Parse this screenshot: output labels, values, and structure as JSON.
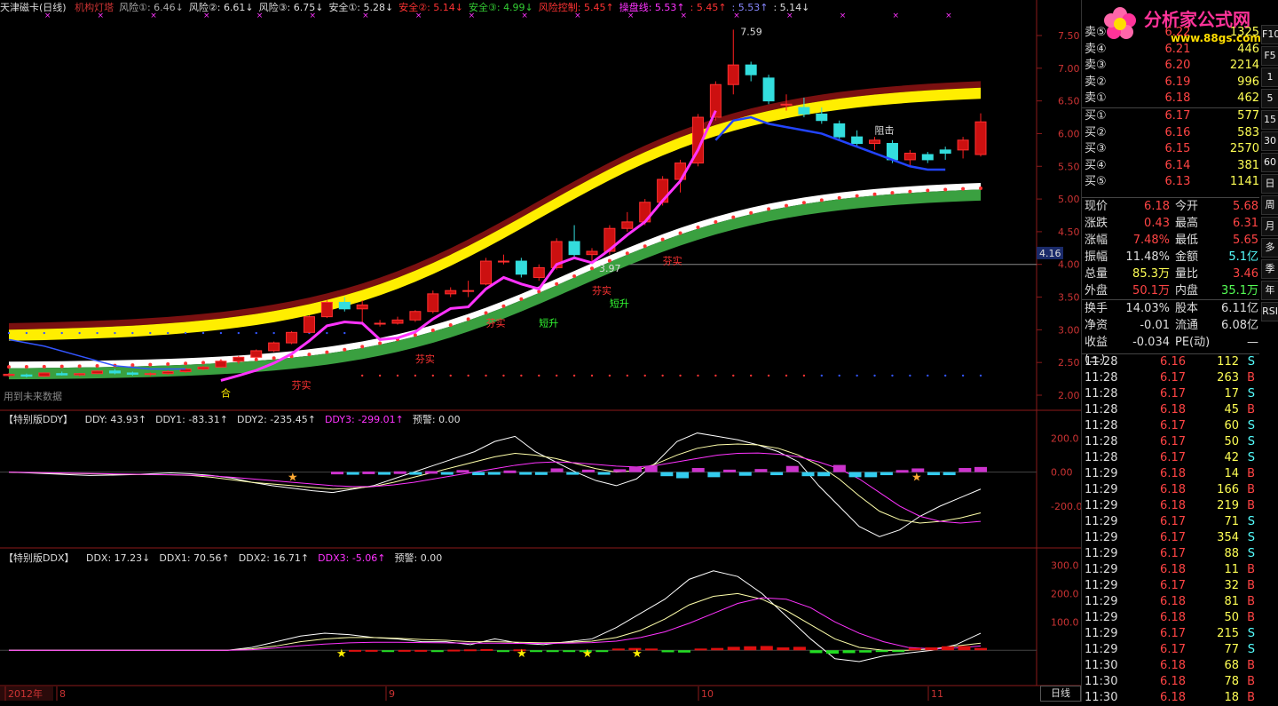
{
  "header": {
    "title": "天津磁卡(日线)",
    "items": [
      {
        "label": "机构灯塔",
        "color": "#cc3333"
      },
      {
        "label": "风险①: 6.46↓",
        "color": "#aaaaaa"
      },
      {
        "label": "风险②: 6.61↓",
        "color": "#dddddd"
      },
      {
        "label": "风险③: 6.75↓",
        "color": "#dddddd"
      },
      {
        "label": "安全①: 5.28↓",
        "color": "#dddddd"
      },
      {
        "label": "安全②: 5.14↓",
        "color": "#ff3333"
      },
      {
        "label": "安全③: 4.99↓",
        "color": "#33cc33"
      },
      {
        "label": "风险控制: 5.45↑",
        "color": "#ff3333"
      },
      {
        "label": "操盘线: 5.53↑",
        "color": "#ff33ff"
      },
      {
        "label": ": 5.45↑",
        "color": "#ff3333"
      },
      {
        "label": ": 5.53↑",
        "color": "#8888ff"
      },
      {
        "label": ": 5.14↓",
        "color": "#dddddd"
      }
    ]
  },
  "main_panel": {
    "future_note": "用到未来数据",
    "annotations": [
      "芬实",
      "芬实",
      "芬实",
      "芬实",
      "芬实",
      "短升",
      "短升",
      "阻击",
      "合"
    ],
    "high_label": "7.59",
    "low_label": "3.97",
    "current_price_box": "4.16",
    "y_ticks": [
      "7.50",
      "7.00",
      "6.50",
      "6.00",
      "5.50",
      "5.00",
      "4.50",
      "4.00",
      "3.50",
      "3.00",
      "2.50",
      "2.00"
    ]
  },
  "ddy_panel": {
    "title": "【特别版DDY】",
    "items": [
      {
        "label": "DDY: 43.93↑",
        "color": "#dddddd"
      },
      {
        "label": "DDY1: -83.31↑",
        "color": "#dddddd"
      },
      {
        "label": "DDY2: -235.45↑",
        "color": "#dddddd"
      },
      {
        "label": "DDY3: -299.01↑",
        "color": "#ff33ff"
      },
      {
        "label": "预警: 0.00",
        "color": "#dddddd"
      }
    ],
    "y_ticks": [
      "200.0",
      "0.00",
      "-200.0"
    ]
  },
  "ddx_panel": {
    "title": "【特别版DDX】",
    "items": [
      {
        "label": "DDX: 17.23↓",
        "color": "#dddddd"
      },
      {
        "label": "DDX1: 70.56↑",
        "color": "#dddddd"
      },
      {
        "label": "DDX2: 16.71↑",
        "color": "#dddddd"
      },
      {
        "label": "DDX3: -5.06↑",
        "color": "#ff33ff"
      },
      {
        "label": "预警: 0.00",
        "color": "#dddddd"
      }
    ],
    "y_ticks": [
      "300.0",
      "200.0",
      "100.0"
    ]
  },
  "time_axis": {
    "labels": [
      "2012年",
      "8",
      "9",
      "10",
      "11"
    ],
    "period": "日线"
  },
  "logo": {
    "title": "分析家公式网",
    "url_text": "www.88gs.com"
  },
  "order_book": {
    "asks": [
      {
        "label": "卖⑤",
        "price": "6.22",
        "vol": "1325"
      },
      {
        "label": "卖④",
        "price": "6.21",
        "vol": "446"
      },
      {
        "label": "卖③",
        "price": "6.20",
        "vol": "2214"
      },
      {
        "label": "卖②",
        "price": "6.19",
        "vol": "996"
      },
      {
        "label": "卖①",
        "price": "6.18",
        "vol": "462"
      }
    ],
    "bids": [
      {
        "label": "买①",
        "price": "6.17",
        "vol": "577"
      },
      {
        "label": "买②",
        "price": "6.16",
        "vol": "583"
      },
      {
        "label": "买③",
        "price": "6.15",
        "vol": "2570"
      },
      {
        "label": "买④",
        "price": "6.14",
        "vol": "381"
      },
      {
        "label": "买⑤",
        "price": "6.13",
        "vol": "1141"
      }
    ]
  },
  "stats": [
    {
      "k1": "现价",
      "v1": "6.18",
      "c1": "#ff4444",
      "k2": "今开",
      "v2": "5.68",
      "c2": "#ff4444"
    },
    {
      "k1": "涨跌",
      "v1": "0.43",
      "c1": "#ff4444",
      "k2": "最高",
      "v2": "6.31",
      "c2": "#ff4444"
    },
    {
      "k1": "涨幅",
      "v1": "7.48%",
      "c1": "#ff4444",
      "k2": "最低",
      "v2": "5.65",
      "c2": "#ff4444"
    },
    {
      "k1": "振幅",
      "v1": "11.48%",
      "c1": "#dddddd",
      "k2": "金额",
      "v2": "5.1亿",
      "c2": "#55ffff"
    },
    {
      "k1": "总量",
      "v1": "85.3万",
      "c1": "#ffff55",
      "k2": "量比",
      "v2": "3.46",
      "c2": "#ff4444"
    },
    {
      "k1": "外盘",
      "v1": "50.1万",
      "c1": "#ff4444",
      "k2": "内盘",
      "v2": "35.1万",
      "c2": "#55ff55"
    },
    {
      "k1": "换手",
      "v1": "14.03%",
      "c1": "#dddddd",
      "k2": "股本",
      "v2": "6.11亿",
      "c2": "#dddddd"
    },
    {
      "k1": "净资",
      "v1": "-0.01",
      "c1": "#dddddd",
      "k2": "流通",
      "v2": "6.08亿",
      "c2": "#dddddd"
    },
    {
      "k1": "收益(三)",
      "v1": "-0.034",
      "c1": "#dddddd",
      "k2": "PE(动)",
      "v2": "—",
      "c2": "#dddddd"
    }
  ],
  "ticks": [
    {
      "t": "11:28",
      "p": "6.16",
      "q": "112",
      "s": "S"
    },
    {
      "t": "11:28",
      "p": "6.17",
      "q": "263",
      "s": "B"
    },
    {
      "t": "11:28",
      "p": "6.17",
      "q": "17",
      "s": "S"
    },
    {
      "t": "11:28",
      "p": "6.18",
      "q": "45",
      "s": "B"
    },
    {
      "t": "11:28",
      "p": "6.17",
      "q": "60",
      "s": "S"
    },
    {
      "t": "11:28",
      "p": "6.17",
      "q": "50",
      "s": "S"
    },
    {
      "t": "11:28",
      "p": "6.17",
      "q": "42",
      "s": "S"
    },
    {
      "t": "11:29",
      "p": "6.18",
      "q": "14",
      "s": "B"
    },
    {
      "t": "11:29",
      "p": "6.18",
      "q": "166",
      "s": "B"
    },
    {
      "t": "11:29",
      "p": "6.18",
      "q": "219",
      "s": "B"
    },
    {
      "t": "11:29",
      "p": "6.17",
      "q": "71",
      "s": "S"
    },
    {
      "t": "11:29",
      "p": "6.17",
      "q": "354",
      "s": "S"
    },
    {
      "t": "11:29",
      "p": "6.17",
      "q": "88",
      "s": "S"
    },
    {
      "t": "11:29",
      "p": "6.18",
      "q": "11",
      "s": "B"
    },
    {
      "t": "11:29",
      "p": "6.17",
      "q": "32",
      "s": "B"
    },
    {
      "t": "11:29",
      "p": "6.18",
      "q": "81",
      "s": "B"
    },
    {
      "t": "11:29",
      "p": "6.18",
      "q": "50",
      "s": "B"
    },
    {
      "t": "11:29",
      "p": "6.17",
      "q": "215",
      "s": "S"
    },
    {
      "t": "11:29",
      "p": "6.17",
      "q": "77",
      "s": "S"
    },
    {
      "t": "11:30",
      "p": "6.18",
      "q": "68",
      "s": "B"
    },
    {
      "t": "11:30",
      "p": "6.18",
      "q": "78",
      "s": "B"
    },
    {
      "t": "11:30",
      "p": "6.18",
      "q": "18",
      "s": "B"
    }
  ],
  "toolbar": [
    "F10",
    "F5",
    "1",
    "5",
    "15",
    "30",
    "60",
    "日",
    "周",
    "月",
    "多",
    "季",
    "年",
    "RSI"
  ],
  "chart_data": {
    "type": "candlestick",
    "title": "天津磁卡(日线)",
    "ylim": [
      1.8,
      7.8
    ],
    "x_months": [
      "8",
      "9",
      "10",
      "11"
    ],
    "candles": [
      [
        2.3,
        2.34,
        2.28,
        2.32
      ],
      [
        2.31,
        2.33,
        2.27,
        2.29
      ],
      [
        2.29,
        2.35,
        2.28,
        2.34
      ],
      [
        2.33,
        2.36,
        2.3,
        2.31
      ],
      [
        2.31,
        2.34,
        2.29,
        2.33
      ],
      [
        2.33,
        2.38,
        2.32,
        2.37
      ],
      [
        2.37,
        2.4,
        2.32,
        2.34
      ],
      [
        2.34,
        2.36,
        2.3,
        2.32
      ],
      [
        2.32,
        2.35,
        2.29,
        2.33
      ],
      [
        2.33,
        2.38,
        2.31,
        2.36
      ],
      [
        2.36,
        2.42,
        2.34,
        2.4
      ],
      [
        2.4,
        2.45,
        2.38,
        2.43
      ],
      [
        2.43,
        2.55,
        2.42,
        2.52
      ],
      [
        2.52,
        2.6,
        2.48,
        2.58
      ],
      [
        2.58,
        2.7,
        2.56,
        2.68
      ],
      [
        2.68,
        2.82,
        2.66,
        2.8
      ],
      [
        2.8,
        2.98,
        2.78,
        2.96
      ],
      [
        2.96,
        3.22,
        2.95,
        3.2
      ],
      [
        3.2,
        3.45,
        3.18,
        3.42
      ],
      [
        3.42,
        3.5,
        3.28,
        3.32
      ],
      [
        3.32,
        3.45,
        3.1,
        3.38
      ],
      [
        3.1,
        3.15,
        3.05,
        3.1
      ],
      [
        3.1,
        3.2,
        3.08,
        3.15
      ],
      [
        3.15,
        3.3,
        3.12,
        3.28
      ],
      [
        3.28,
        3.6,
        3.25,
        3.55
      ],
      [
        3.55,
        3.65,
        3.5,
        3.6
      ],
      [
        3.6,
        3.75,
        3.5,
        3.6
      ],
      [
        3.7,
        4.1,
        3.68,
        4.05
      ],
      [
        4.05,
        4.15,
        4.0,
        4.05
      ],
      [
        4.05,
        4.1,
        3.8,
        3.85
      ],
      [
        3.8,
        4.0,
        3.75,
        3.95
      ],
      [
        3.95,
        4.4,
        3.92,
        4.35
      ],
      [
        4.35,
        4.6,
        4.1,
        4.15
      ],
      [
        4.15,
        4.25,
        4.05,
        4.2
      ],
      [
        4.2,
        4.6,
        4.15,
        4.55
      ],
      [
        4.55,
        4.8,
        4.5,
        4.65
      ],
      [
        4.65,
        5.0,
        4.6,
        4.95
      ],
      [
        4.95,
        5.35,
        4.9,
        5.3
      ],
      [
        5.3,
        5.6,
        5.1,
        5.55
      ],
      [
        5.55,
        6.3,
        5.5,
        6.25
      ],
      [
        6.25,
        6.8,
        6.2,
        6.75
      ],
      [
        6.75,
        7.59,
        6.6,
        7.05
      ],
      [
        7.05,
        7.1,
        6.8,
        6.9
      ],
      [
        6.85,
        6.9,
        6.45,
        6.5
      ],
      [
        6.45,
        6.6,
        6.35,
        6.45
      ],
      [
        6.4,
        6.55,
        6.25,
        6.3
      ],
      [
        6.3,
        6.4,
        6.15,
        6.2
      ],
      [
        6.15,
        6.2,
        5.9,
        5.95
      ],
      [
        5.95,
        6.05,
        5.8,
        5.85
      ],
      [
        5.85,
        5.95,
        5.75,
        5.9
      ],
      [
        5.85,
        5.9,
        5.55,
        5.6
      ],
      [
        5.6,
        5.75,
        5.5,
        5.7
      ],
      [
        5.68,
        5.72,
        5.55,
        5.6
      ],
      [
        5.75,
        5.8,
        5.6,
        5.7
      ],
      [
        5.75,
        5.95,
        5.62,
        5.9
      ],
      [
        5.68,
        6.31,
        5.65,
        6.18
      ]
    ],
    "ddy": {
      "ddy1": [
        0,
        -5,
        -10,
        -15,
        -20,
        -18,
        -15,
        -10,
        -5,
        -10,
        -20,
        -35,
        -60,
        -80,
        -95,
        -110,
        -120,
        -100,
        -80,
        -40,
        0,
        40,
        80,
        120,
        180,
        210,
        120,
        60,
        0,
        -50,
        -80,
        -40,
        60,
        180,
        230,
        210,
        190,
        160,
        120,
        60,
        -80,
        -200,
        -320,
        -380,
        -340,
        -260,
        -200,
        -150,
        -100
      ],
      "ddy2": [
        0,
        -3,
        -6,
        -8,
        -10,
        -12,
        -14,
        -15,
        -16,
        -20,
        -30,
        -45,
        -60,
        -70,
        -80,
        -90,
        -100,
        -95,
        -85,
        -60,
        -30,
        0,
        30,
        60,
        90,
        110,
        100,
        80,
        50,
        20,
        0,
        10,
        50,
        100,
        140,
        160,
        165,
        160,
        140,
        100,
        40,
        -40,
        -140,
        -230,
        -280,
        -300,
        -290,
        -270,
        -240
      ],
      "ddy3": [
        0,
        -2,
        -4,
        -6,
        -8,
        -10,
        -12,
        -14,
        -16,
        -18,
        -22,
        -30,
        -40,
        -50,
        -60,
        -70,
        -80,
        -85,
        -85,
        -75,
        -60,
        -40,
        -20,
        0,
        20,
        40,
        55,
        60,
        55,
        45,
        35,
        30,
        40,
        60,
        80,
        100,
        110,
        112,
        105,
        90,
        60,
        20,
        -40,
        -120,
        -200,
        -260,
        -290,
        -300,
        -290
      ],
      "bars": [
        2,
        -5,
        3,
        -8,
        4,
        -10,
        5,
        -12,
        10,
        -15,
        -12,
        8,
        -10,
        -14,
        18,
        -10,
        12,
        -8,
        14,
        25,
        30,
        -20,
        -30,
        20,
        -25,
        12,
        -18,
        15,
        -15,
        30,
        -20,
        -20,
        35,
        -25,
        -25,
        -15,
        10,
        18,
        -15,
        -15,
        20,
        25
      ]
    },
    "ddx": {
      "ddx1": [
        0,
        0,
        0,
        0,
        0,
        0,
        0,
        0,
        0,
        0,
        10,
        30,
        50,
        60,
        55,
        45,
        40,
        30,
        30,
        20,
        40,
        25,
        20,
        30,
        40,
        80,
        130,
        180,
        250,
        280,
        260,
        200,
        120,
        40,
        -30,
        -40,
        -20,
        -10,
        0,
        20,
        60
      ],
      "ddx2": [
        0,
        0,
        0,
        0,
        0,
        0,
        0,
        0,
        0,
        0,
        5,
        15,
        30,
        40,
        45,
        45,
        42,
        38,
        35,
        30,
        30,
        28,
        26,
        28,
        32,
        45,
        70,
        110,
        160,
        190,
        200,
        180,
        140,
        90,
        40,
        10,
        0,
        0,
        5,
        15,
        25
      ],
      "ddx3": [
        0,
        0,
        0,
        0,
        0,
        0,
        0,
        0,
        0,
        0,
        2,
        8,
        16,
        22,
        26,
        28,
        28,
        27,
        26,
        25,
        25,
        24,
        24,
        25,
        27,
        32,
        45,
        65,
        95,
        130,
        165,
        185,
        180,
        150,
        100,
        60,
        30,
        10,
        5,
        8,
        15
      ],
      "bars": [
        1,
        1,
        -1,
        1,
        1,
        -1,
        2,
        3,
        4,
        -3,
        3,
        -4,
        -5,
        -6,
        -5,
        -6,
        6,
        8,
        6,
        -7,
        -8,
        6,
        8,
        12,
        14,
        15,
        10,
        12,
        -10,
        -12,
        -10,
        -8,
        -6,
        -5,
        8,
        10,
        14,
        15,
        8
      ]
    }
  }
}
